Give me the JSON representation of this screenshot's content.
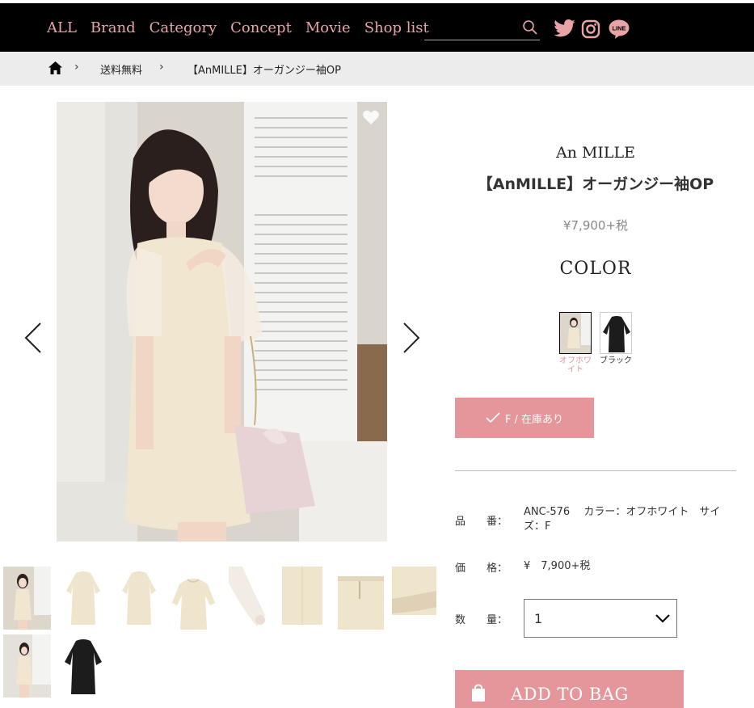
{
  "nav": {
    "items": [
      "ALL",
      "Brand",
      "Category",
      "Concept",
      "Movie",
      "Shop list"
    ],
    "search_placeholder": "",
    "accent": "#e9a4a6"
  },
  "breadcrumb": {
    "items": [
      "送料無料",
      "【AnMILLE】オーガンジー袖OP"
    ]
  },
  "product": {
    "brand": "An MILLE",
    "name": "【AnMILLE】オーガンジー袖OP",
    "price": "¥7,900+税",
    "color_heading": "COLOR",
    "colors": [
      {
        "label": "オフホワイト",
        "selected": true,
        "color": "#e5969a"
      },
      {
        "label": "ブラック",
        "selected": false,
        "color": "#333333"
      }
    ],
    "stock_button": "F / 在庫あり",
    "specs": [
      {
        "key": "品　　番：",
        "value": "ANC-576　 カラー：オフホワイト　サイズ：F"
      },
      {
        "key": "価　　格：",
        "value": "¥　7,900+税"
      },
      {
        "key": "数　　量：",
        "value": ""
      }
    ],
    "quantity": "1",
    "add_to_bag": "ADD TO BAG"
  },
  "theme": {
    "button_pink": "#e5969a",
    "dress_cream": "#efe4cc"
  },
  "icons": [
    "search-icon",
    "twitter-icon",
    "instagram-icon",
    "line-icon",
    "home-icon",
    "heart-icon",
    "chevron-left-icon",
    "chevron-right-icon",
    "check-icon",
    "bag-icon",
    "chevron-down-icon"
  ]
}
